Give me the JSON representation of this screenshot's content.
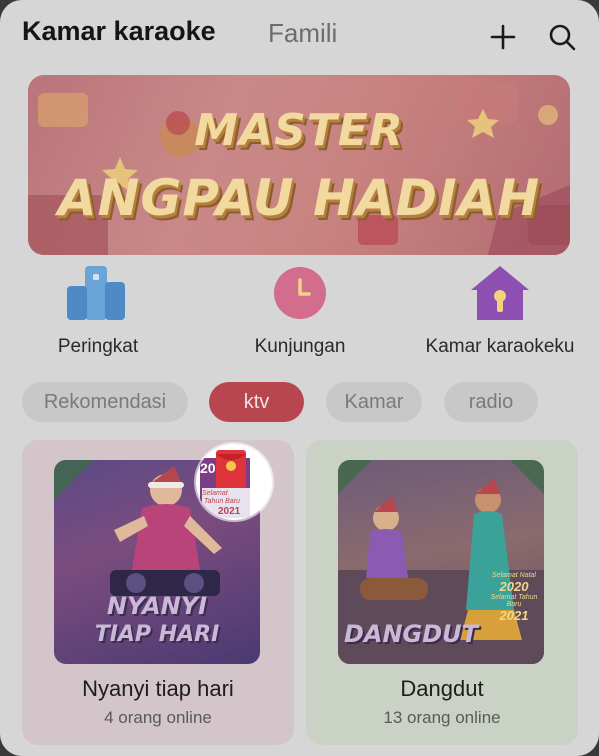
{
  "header": {
    "tab_active": "Kamar karaoke",
    "tab_inactive": "Famili",
    "add_icon": "plus-icon",
    "search_icon": "search-icon"
  },
  "banner": {
    "line1": "MASTER",
    "line2": "ANGPAU HADIAH"
  },
  "quick_nav": [
    {
      "label": "Peringkat",
      "icon": "ranking-podium-icon"
    },
    {
      "label": "Kunjungan",
      "icon": "clock-icon"
    },
    {
      "label": "Kamar karaokeku",
      "icon": "house-icon"
    }
  ],
  "chips": [
    {
      "label": "Rekomendasi",
      "active": false
    },
    {
      "label": "ktv",
      "active": true
    },
    {
      "label": "Kamar",
      "active": false
    },
    {
      "label": "radio",
      "active": false
    }
  ],
  "cards": [
    {
      "title": "Nyanyi tiap hari",
      "subtitle": "4 orang online",
      "thumb_text_1": "NYANYI",
      "thumb_text_2": "TIAP HARI"
    },
    {
      "title": "Dangdut",
      "subtitle": "13 orang online",
      "thumb_text_1": "DANGDUT",
      "greeting_1": "Selamat Natal",
      "greeting_2": "2020",
      "greeting_3": "Selamat Tahun Baru",
      "greeting_4": "2021"
    }
  ],
  "badge": {
    "icon": "red-packet-icon",
    "text_year_top": "20",
    "text_line": "Selamat",
    "text_line2": "Tahun Baru",
    "text_year_bottom": "2021"
  },
  "colors": {
    "overlay_bg": "#d6d6d6",
    "active_chip": "#b8464f",
    "card_pink": "#d3c5ca",
    "card_green": "#c9d2c5"
  }
}
